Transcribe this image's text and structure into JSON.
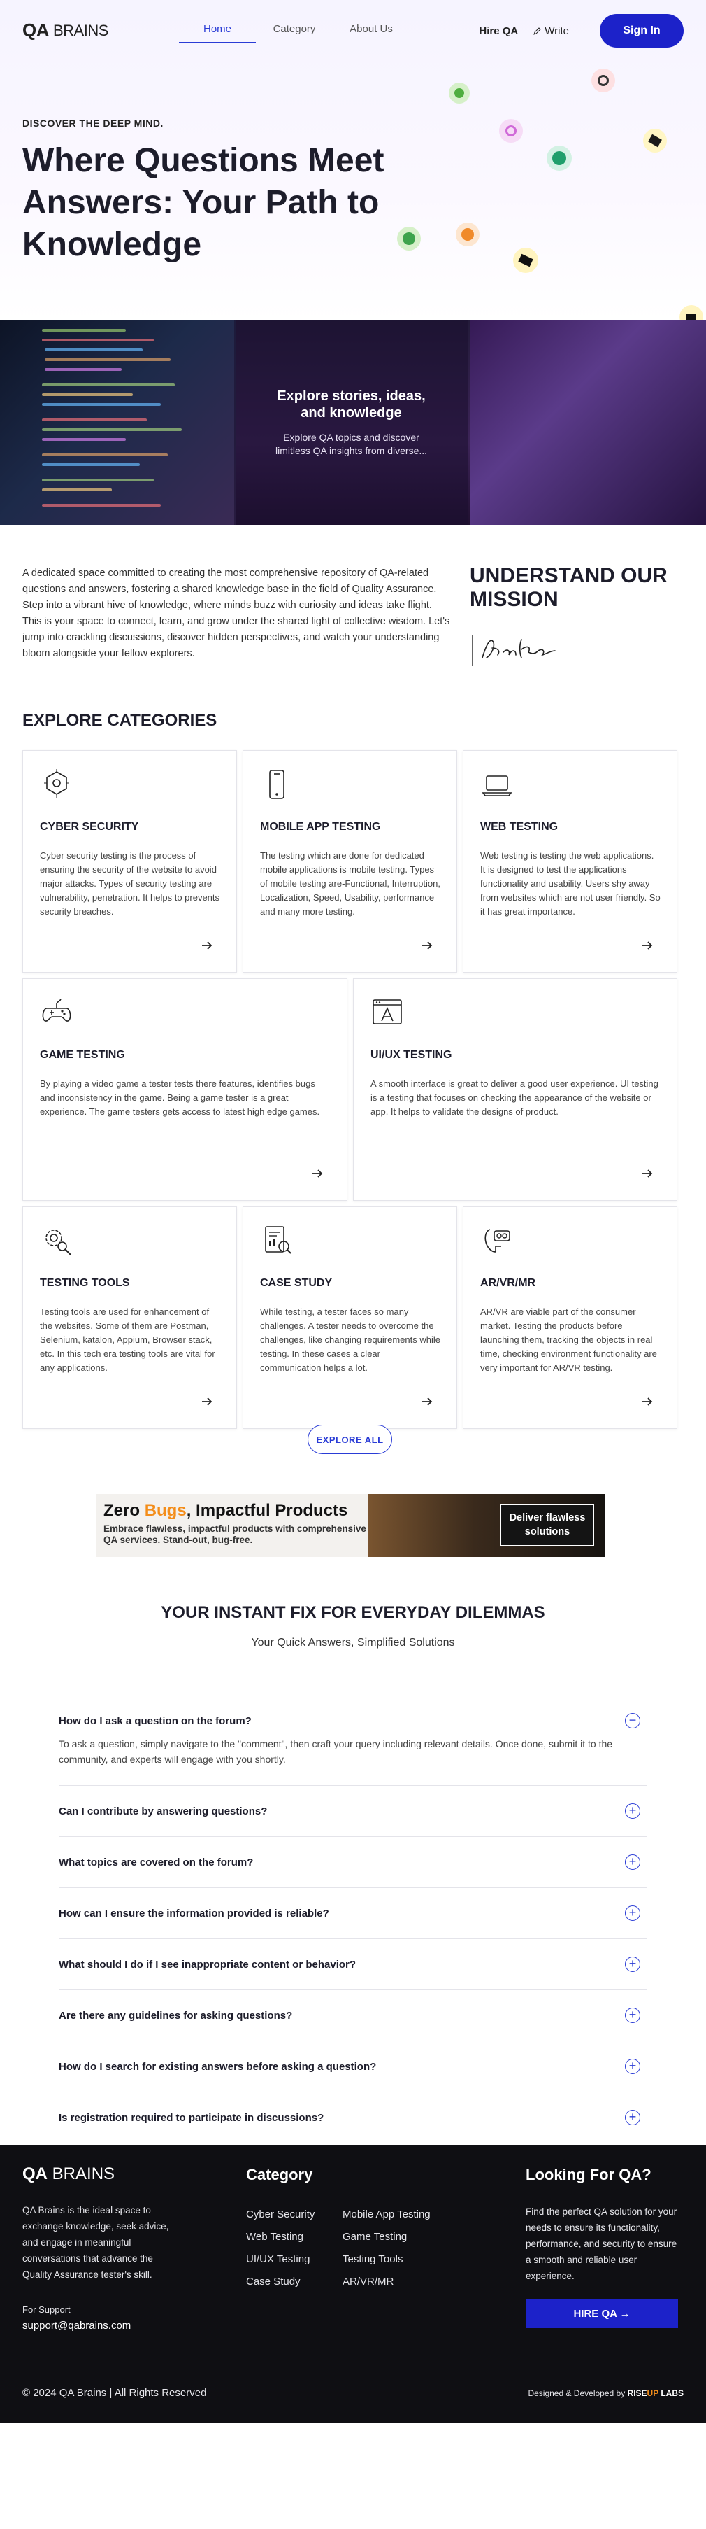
{
  "header": {
    "logo_bold": "QA",
    "logo_light": "BRAINS",
    "nav": [
      "Home",
      "Category",
      "About Us"
    ],
    "hire": "Hire QA",
    "write": "Write",
    "signin": "Sign In"
  },
  "hero": {
    "kicker": "DISCOVER THE DEEP MIND.",
    "title": "Where Questions Meet Answers: Your Path to Knowledge"
  },
  "strip": {
    "title": "Explore stories, ideas, and knowledge",
    "subtitle": "Explore QA topics and discover limitless QA insights from diverse..."
  },
  "intro": {
    "text": "A dedicated space committed to creating the most comprehensive repository of QA-related questions and answers, fostering a shared knowledge base in the field of Quality Assurance. Step into a vibrant hive of knowledge, where minds buzz with curiosity and ideas take flight. This is your space to connect, learn, and grow under the shared light of collective wisdom. Let's jump into crackling discussions, discover hidden perspectives, and watch your understanding bloom alongside your fellow explorers.",
    "mission_title": "UNDERSTAND OUR MISSION",
    "signature": "And Kno"
  },
  "categories": {
    "heading": "EXPLORE CATEGORIES",
    "items": [
      {
        "title": "CYBER SECURITY",
        "icon": "cyber-security-icon",
        "text": "Cyber security testing is the process of ensuring the security of the website to avoid major attacks. Types of security testing are vulnerability, penetration. It helps to prevents security breaches."
      },
      {
        "title": "MOBILE APP TESTING",
        "icon": "mobile-icon",
        "text": "The testing which are done for dedicated mobile applications is mobile testing. Types of mobile testing are-Functional, Interruption, Localization, Speed, Usability, performance and many more testing."
      },
      {
        "title": "WEB TESTING",
        "icon": "laptop-icon",
        "text": "Web testing is testing the web applications. It is designed to test the applications functionality and usability. Users shy away from websites which are not user friendly. So it has great importance."
      },
      {
        "title": "GAME TESTING",
        "icon": "gamepad-icon",
        "text": "By playing a video game a tester tests there features, identifies bugs and inconsistency in the game. Being a game tester is a great experience. The game testers gets access to latest high edge games."
      },
      {
        "title": "UI/UX TESTING",
        "icon": "ui-ux-icon",
        "text": "A smooth interface is great to deliver a good user experience. UI testing is a testing that focuses on checking the appearance of the website or app. It helps to validate the designs of product."
      },
      {
        "title": "TESTING TOOLS",
        "icon": "gear-search-icon",
        "text": "Testing tools are used for enhancement of the websites. Some of them are Postman, Selenium, katalon, Appium, Browser stack, etc. In this tech era testing tools are vital for any applications."
      },
      {
        "title": "CASE STUDY",
        "icon": "report-icon",
        "text": "While testing, a tester faces so many challenges. A tester needs to overcome the challenges, like changing requirements while testing. In these cases a clear communication helps a lot."
      },
      {
        "title": "AR/VR/MR",
        "icon": "vr-headset-icon",
        "text": "AR/VR are viable part of the consumer market. Testing the products before launching them, tracking the objects in real time, checking environment functionality are very important for AR/VR testing."
      }
    ],
    "explore_all": "EXPLORE ALL"
  },
  "banner": {
    "headline_1": "Zero ",
    "headline_2": "Bugs",
    "headline_3": ", Impactful Products",
    "body": "Embrace flawless, impactful products with comprehensive QA services. Stand-out, bug-free.",
    "cta": "Deliver flawless solutions",
    "accent": "#f38d1a"
  },
  "faq": {
    "title": "YOUR INSTANT FIX FOR EVERYDAY DILEMMAS",
    "subtitle": "Your Quick Answers, Simplified Solutions",
    "items": [
      {
        "q": "How do I ask a question on the forum?",
        "a": "To ask a question, simply navigate to the \"comment\", then craft your query including relevant details. Once done, submit it to the community, and experts will engage with you shortly.",
        "toggle": "−"
      },
      {
        "q": "Can I contribute by answering questions?",
        "toggle": "+"
      },
      {
        "q": "What topics are covered on the forum?",
        "toggle": "+"
      },
      {
        "q": "How can I ensure the information provided is reliable?",
        "toggle": "+"
      },
      {
        "q": "What should I do if I see inappropriate content or behavior?",
        "toggle": "+"
      },
      {
        "q": "Are there any guidelines for asking questions?",
        "toggle": "+"
      },
      {
        "q": "How do I search for existing answers before asking a question?",
        "toggle": "+"
      },
      {
        "q": "Is registration required to participate in discussions?",
        "toggle": "+"
      }
    ]
  },
  "footer": {
    "logo_bold": "QA",
    "logo_light": "BRAINS",
    "desc": "QA Brains is the ideal space to exchange knowledge, seek advice, and engage in meaningful conversations that advance the Quality Assurance tester's skill.",
    "support_label": "For Support",
    "support_email": "support@qabrains.com",
    "category_heading": "Category",
    "col1": [
      "Cyber Security",
      "Web Testing",
      "UI/UX Testing",
      "Case Study"
    ],
    "col2": [
      "Mobile App Testing",
      "Game Testing",
      "Testing Tools",
      "AR/VR/MR"
    ],
    "looking_heading": "Looking For QA?",
    "looking_text": "Find the perfect QA solution for your needs to ensure its functionality, performance, and security to ensure a smooth and reliable user experience.",
    "hire_btn": "HIRE QA",
    "copyright": "© 2024 QA Brains | All Rights Reserved",
    "dev_prefix": "Designed & Developed by ",
    "dev_rise": "RISE",
    "dev_up": "UP",
    "dev_labs": " LABS"
  },
  "colors": {
    "primary": "#1c22c9",
    "accent": "#f38d1a",
    "footer_bg": "#0f0f13"
  }
}
